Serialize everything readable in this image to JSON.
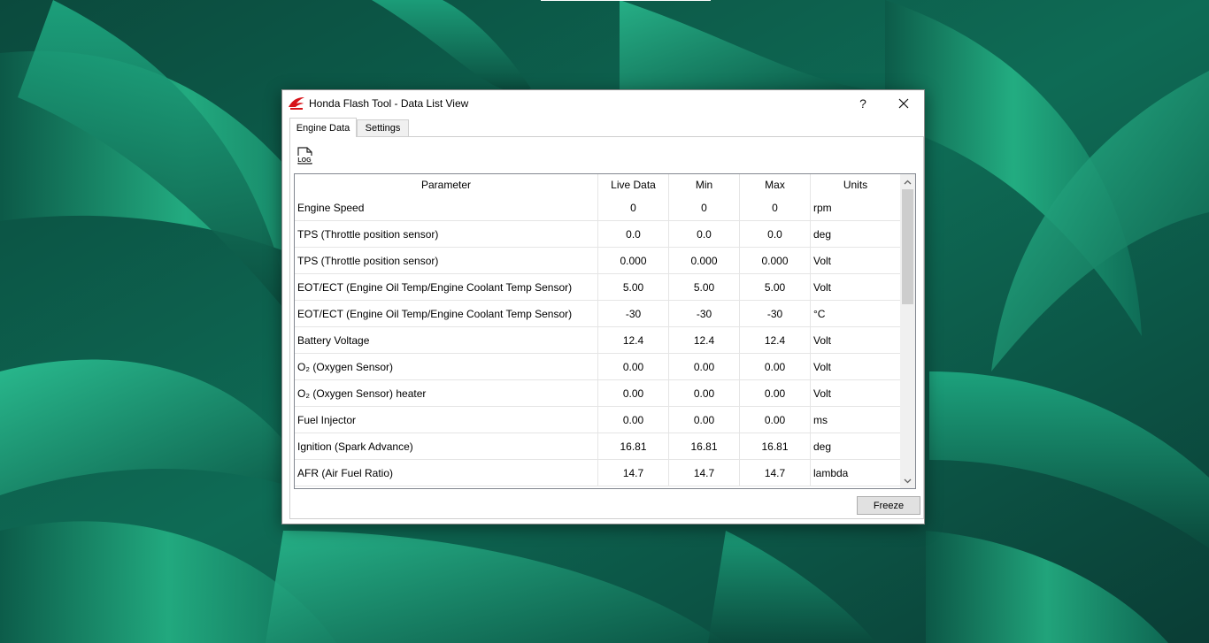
{
  "window": {
    "title": "Honda Flash Tool - Data List View",
    "help_label": "?",
    "close_label": "✕"
  },
  "tabs": [
    {
      "label": "Engine Data",
      "active": true
    },
    {
      "label": "Settings",
      "active": false
    }
  ],
  "toolbar": {
    "log_icon_text": "LOG"
  },
  "table": {
    "columns": [
      "Parameter",
      "Live Data",
      "Min",
      "Max",
      "Units"
    ],
    "rows": [
      [
        "Engine Speed",
        "0",
        "0",
        "0",
        "rpm"
      ],
      [
        "TPS (Throttle position sensor)",
        "0.0",
        "0.0",
        "0.0",
        "deg"
      ],
      [
        "TPS (Throttle position sensor)",
        "0.000",
        "0.000",
        "0.000",
        "Volt"
      ],
      [
        "EOT/ECT (Engine Oil Temp/Engine Coolant Temp Sensor)",
        "5.00",
        "5.00",
        "5.00",
        "Volt"
      ],
      [
        "EOT/ECT (Engine Oil Temp/Engine Coolant Temp Sensor)",
        "-30",
        "-30",
        "-30",
        "°C"
      ],
      [
        "Battery Voltage",
        "12.4",
        "12.4",
        "12.4",
        "Volt"
      ],
      [
        "O₂ (Oxygen Sensor)",
        "0.00",
        "0.00",
        "0.00",
        "Volt"
      ],
      [
        "O₂ (Oxygen Sensor) heater",
        "0.00",
        "0.00",
        "0.00",
        "Volt"
      ],
      [
        "Fuel Injector",
        "0.00",
        "0.00",
        "0.00",
        "ms"
      ],
      [
        "Ignition (Spark Advance)",
        "16.81",
        "16.81",
        "16.81",
        "deg"
      ],
      [
        "AFR (Air Fuel Ratio)",
        "14.7",
        "14.7",
        "14.7",
        "lambda"
      ]
    ]
  },
  "buttons": {
    "freeze_label": "Freeze"
  },
  "colors": {
    "honda_red": "#d7141a",
    "wallpaper_green": "#1f9a74"
  }
}
